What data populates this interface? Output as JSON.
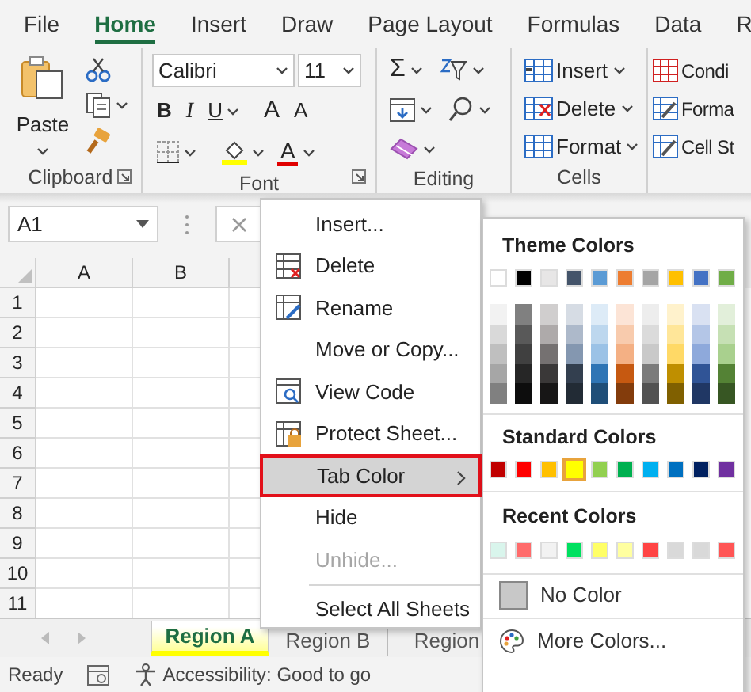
{
  "ribbon_tabs": [
    {
      "label": "File",
      "selected": false
    },
    {
      "label": "Home",
      "selected": true
    },
    {
      "label": "Insert",
      "selected": false
    },
    {
      "label": "Draw",
      "selected": false
    },
    {
      "label": "Page Layout",
      "selected": false
    },
    {
      "label": "Formulas",
      "selected": false
    },
    {
      "label": "Data",
      "selected": false
    },
    {
      "label": "R",
      "selected": false
    }
  ],
  "clipboard": {
    "paste": "Paste",
    "label": "Clipboard"
  },
  "font": {
    "name": "Calibri",
    "size": "11",
    "bold": "B",
    "italic": "I",
    "underline": "U",
    "grow": "A",
    "shrink": "A",
    "font_color": "A",
    "label": "Font"
  },
  "editing": {
    "sum": "Σ",
    "label": "Editing"
  },
  "cells": {
    "buttons": [
      "Insert",
      "Delete",
      "Format"
    ],
    "label": "Cells"
  },
  "styles": {
    "buttons": [
      "Condi",
      "Forma",
      "Cell St"
    ]
  },
  "name_box": {
    "value": "A1"
  },
  "grid": {
    "columns": [
      "A",
      "B"
    ],
    "rows": [
      "1",
      "2",
      "3",
      "4",
      "5",
      "6",
      "7",
      "8",
      "9",
      "10",
      "11"
    ]
  },
  "context_menu": {
    "items": [
      {
        "label": "Insert...",
        "selected": false,
        "disabled": false
      },
      {
        "label": "Delete",
        "selected": false,
        "disabled": false
      },
      {
        "label": "Rename",
        "selected": false,
        "disabled": false
      },
      {
        "label": "Move or Copy...",
        "selected": false,
        "disabled": false
      },
      {
        "label": "View Code",
        "selected": false,
        "disabled": false
      },
      {
        "label": "Protect Sheet...",
        "selected": false,
        "disabled": false
      },
      {
        "label": "Tab Color",
        "selected": true,
        "disabled": false,
        "submenu": true
      },
      {
        "label": "Hide",
        "selected": false,
        "disabled": false
      },
      {
        "label": "Unhide...",
        "selected": false,
        "disabled": true
      },
      {
        "label": "Select All Sheets",
        "selected": false,
        "disabled": false,
        "separator_before": true
      }
    ]
  },
  "tab_color_menu": {
    "theme_heading": "Theme Colors",
    "theme": [
      {
        "color": "#ffffff"
      },
      {
        "color": "#000000"
      },
      {
        "color": "#e7e6e6"
      },
      {
        "color": "#44546a"
      },
      {
        "color": "#5b9bd5"
      },
      {
        "color": "#ed7d31"
      },
      {
        "color": "#a5a5a5"
      },
      {
        "color": "#ffc000"
      },
      {
        "color": "#4472c4"
      },
      {
        "color": "#70ad47"
      }
    ],
    "shades": [
      {
        "swatches": [
          {
            "color": "#f2f2f2"
          },
          {
            "color": "#d9d9d9"
          },
          {
            "color": "#bfbfbf"
          },
          {
            "color": "#a6a6a6"
          },
          {
            "color": "#808080"
          }
        ]
      },
      {
        "swatches": [
          {
            "color": "#808080"
          },
          {
            "color": "#595959"
          },
          {
            "color": "#404040"
          },
          {
            "color": "#262626"
          },
          {
            "color": "#0d0d0d"
          }
        ]
      },
      {
        "swatches": [
          {
            "color": "#d0cece"
          },
          {
            "color": "#aeaaaa"
          },
          {
            "color": "#757171"
          },
          {
            "color": "#3a3838"
          },
          {
            "color": "#171616"
          }
        ]
      },
      {
        "swatches": [
          {
            "color": "#d6dce4"
          },
          {
            "color": "#adb9ca"
          },
          {
            "color": "#8497b0"
          },
          {
            "color": "#333f4f"
          },
          {
            "color": "#222b35"
          }
        ]
      },
      {
        "swatches": [
          {
            "color": "#ddebf7"
          },
          {
            "color": "#bdd7ee"
          },
          {
            "color": "#9bc2e6"
          },
          {
            "color": "#2f75b5"
          },
          {
            "color": "#1f4e78"
          }
        ]
      },
      {
        "swatches": [
          {
            "color": "#fce4d6"
          },
          {
            "color": "#f8cbad"
          },
          {
            "color": "#f4b084"
          },
          {
            "color": "#c65911"
          },
          {
            "color": "#833c0c"
          }
        ]
      },
      {
        "swatches": [
          {
            "color": "#ededed"
          },
          {
            "color": "#dbdbdb"
          },
          {
            "color": "#c9c9c9"
          },
          {
            "color": "#7b7b7b"
          },
          {
            "color": "#525252"
          }
        ]
      },
      {
        "swatches": [
          {
            "color": "#fff2cc"
          },
          {
            "color": "#ffe699"
          },
          {
            "color": "#ffd966"
          },
          {
            "color": "#bf8f00"
          },
          {
            "color": "#806000"
          }
        ]
      },
      {
        "swatches": [
          {
            "color": "#d9e1f2"
          },
          {
            "color": "#b4c6e7"
          },
          {
            "color": "#8ea9db"
          },
          {
            "color": "#305496"
          },
          {
            "color": "#203764"
          }
        ]
      },
      {
        "swatches": [
          {
            "color": "#e2efda"
          },
          {
            "color": "#c6e0b4"
          },
          {
            "color": "#a9d08e"
          },
          {
            "color": "#548235"
          },
          {
            "color": "#375623"
          }
        ]
      }
    ],
    "standard_heading": "Standard Colors",
    "standard": [
      {
        "color": "#c00000",
        "selected": false
      },
      {
        "color": "#ff0000",
        "selected": false
      },
      {
        "color": "#ffc000",
        "selected": false
      },
      {
        "color": "#ffff00",
        "selected": true
      },
      {
        "color": "#92d050",
        "selected": false
      },
      {
        "color": "#00b050",
        "selected": false
      },
      {
        "color": "#00b0f0",
        "selected": false
      },
      {
        "color": "#0070c0",
        "selected": false
      },
      {
        "color": "#002060",
        "selected": false
      },
      {
        "color": "#7030a0",
        "selected": false
      }
    ],
    "recent_heading": "Recent Colors",
    "recent": [
      {
        "color": "#d9f5ec"
      },
      {
        "color": "#ff6b6b"
      },
      {
        "color": "#f2f2f2"
      },
      {
        "color": "#00e060"
      },
      {
        "color": "#ffff66"
      },
      {
        "color": "#ffffa0"
      },
      {
        "color": "#ff4444"
      },
      {
        "color": "#d9d9d9"
      },
      {
        "color": "#d9d9d9"
      },
      {
        "color": "#ff5555"
      }
    ],
    "no_color": "No Color",
    "more_colors": "More Colors..."
  },
  "sheet_tabs": [
    {
      "label": "Region A",
      "selected": true,
      "color": "#ffff00"
    },
    {
      "label": "Region B",
      "selected": false
    },
    {
      "label": "Region",
      "selected": false
    }
  ],
  "status_bar": {
    "ready": "Ready",
    "accessibility": "Accessibility: Good to go"
  }
}
